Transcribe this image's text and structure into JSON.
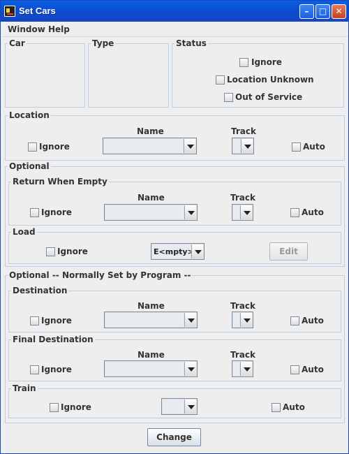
{
  "window": {
    "title": "Set Cars"
  },
  "menu": {
    "items": [
      "Window",
      "Help"
    ]
  },
  "car_panel": {
    "title": "Car"
  },
  "type_panel": {
    "title": "Type"
  },
  "status_panel": {
    "title": "Status",
    "ignore": "Ignore",
    "location_unknown": "Location Unknown",
    "out_of_service": "Out of Service"
  },
  "location": {
    "title": "Location",
    "name_label": "Name",
    "track_label": "Track",
    "ignore": "Ignore",
    "auto": "Auto",
    "name_value": "",
    "track_value": ""
  },
  "optional": {
    "title": "Optional",
    "return_when_empty": {
      "title": "Return When Empty",
      "name_label": "Name",
      "track_label": "Track",
      "ignore": "Ignore",
      "auto": "Auto"
    },
    "load": {
      "title": "Load",
      "ignore": "Ignore",
      "value": "E<mpty>",
      "edit_button": "Edit"
    }
  },
  "program": {
    "title": "Optional -- Normally Set by Program --",
    "destination": {
      "title": "Destination",
      "name_label": "Name",
      "track_label": "Track",
      "ignore": "Ignore",
      "auto": "Auto"
    },
    "final_destination": {
      "title": "Final Destination",
      "name_label": "Name",
      "track_label": "Track",
      "ignore": "Ignore",
      "auto": "Auto"
    },
    "train": {
      "title": "Train",
      "ignore": "Ignore",
      "auto": "Auto",
      "value": ""
    }
  },
  "change_button": "Change"
}
